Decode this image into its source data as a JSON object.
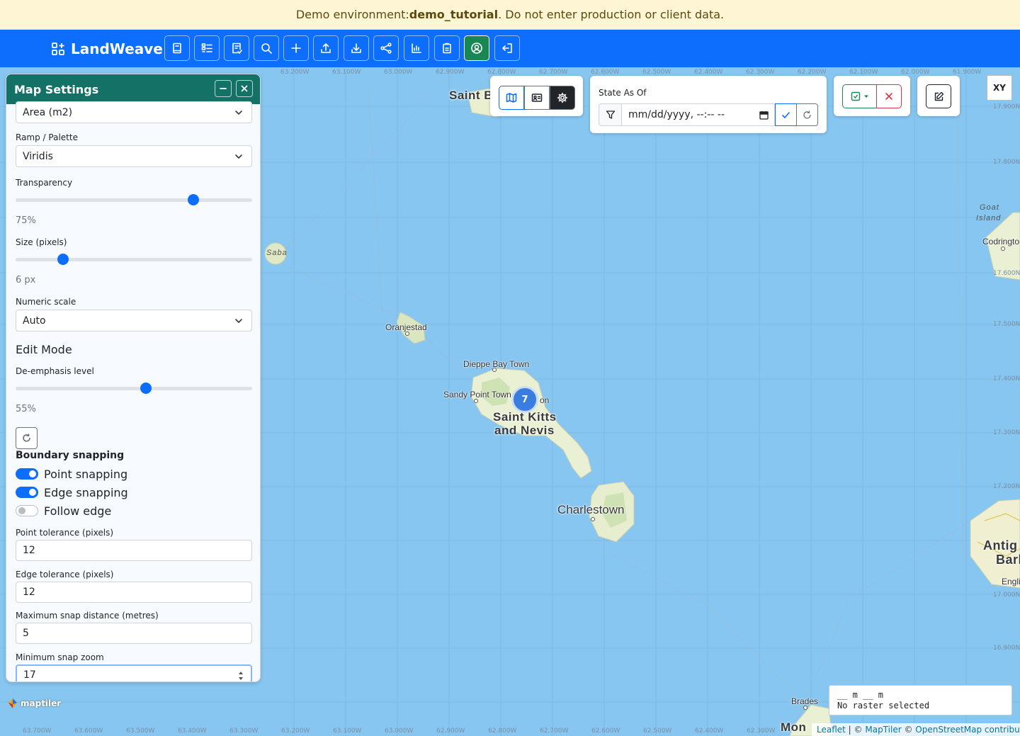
{
  "banner": {
    "prefix": "Demo environment: ",
    "env": "demo_tutorial",
    "suffix": ". Do not enter production or client data."
  },
  "navbar": {
    "brand": "LandWeave",
    "buttons": [
      "book-icon",
      "list-icon",
      "review-icon",
      "search-icon",
      "plus-icon",
      "upload-icon",
      "download-icon",
      "network-icon",
      "chart-icon",
      "clipboard-icon",
      "user-circle-icon",
      "logout-icon"
    ]
  },
  "map_settings": {
    "title": "Map Settings",
    "attribute_value": "Area (m2)",
    "ramp_label": "Ramp / Palette",
    "ramp_value": "Viridis",
    "transparency_label": "Transparency",
    "transparency_pct": 75,
    "transparency_text": "75%",
    "size_label": "Size (pixels)",
    "size_value": 6,
    "size_max": 30,
    "size_text": "6 px",
    "numeric_scale_label": "Numeric scale",
    "numeric_scale_value": "Auto",
    "edit_mode_heading": "Edit Mode",
    "deemphasis_label": "De-emphasis level",
    "deemphasis_pct": 55,
    "deemphasis_text": "55%",
    "boundary_snapping_heading": "Boundary snapping",
    "point_snapping": {
      "label": "Point snapping",
      "on": true
    },
    "edge_snapping": {
      "label": "Edge snapping",
      "on": true
    },
    "follow_edge": {
      "label": "Follow edge",
      "on": false
    },
    "point_tolerance_label": "Point tolerance (pixels)",
    "point_tolerance_value": "12",
    "edge_tolerance_label": "Edge tolerance (pixels)",
    "edge_tolerance_value": "12",
    "max_snap_label": "Maximum snap distance (metres)",
    "max_snap_value": "5",
    "min_snap_zoom_label": "Minimum snap zoom",
    "min_snap_zoom_value": "17"
  },
  "toolbar": {
    "views": [
      "map-icon",
      "id-card-icon",
      "gear-icon"
    ],
    "state_as_of_label": "State As Of",
    "datetime_placeholder": "mm/dd/yyyy, --:-- --"
  },
  "map": {
    "top_coords": [
      "63.200W",
      "63.100W",
      "63.000W",
      "62.900W",
      "62.800W",
      "62.700W",
      "62.600W",
      "62.500W",
      "62.400W",
      "62.300W",
      "62.200W",
      "62.100W",
      "62.000W",
      "61.900W"
    ],
    "bottom_coords": [
      "63.700W",
      "63.600W",
      "63.500W",
      "63.400W",
      "63.300W",
      "63.200W",
      "63.100W",
      "63.000W",
      "62.900W",
      "62.800W",
      "62.700W",
      "62.600W",
      "62.500W",
      "62.400W",
      "62.300W"
    ],
    "right_coords": [
      "17.900N",
      "17.800N",
      "17.600N",
      "17.500N",
      "17.400N",
      "17.300N",
      "17.200N",
      "17.000N",
      "16.900N"
    ],
    "places": {
      "saint_barth": "Saint Barthélemy",
      "saba": "Saba",
      "oranjestad": "Oranjestad",
      "dieppe": "Dieppe Bay Town",
      "sandy_point": "Sandy Point Town",
      "basseterre_frag": "on",
      "skn_line1": "Saint Kitts",
      "skn_line2": "and Nevis",
      "charlestown": "Charlestown",
      "goat_island_1": "Goat",
      "goat_island_2": "Island",
      "codrington": "Codrington",
      "antigua_1": "Antig",
      "antigua_2": "Barb",
      "engl": "Engli",
      "brades": "Brades",
      "mont": "Mon"
    },
    "cluster_count": "7",
    "xy_button": "XY",
    "scale_line": "__ m __ m",
    "raster_status": "No raster selected",
    "maptiler_logo": "maptiler",
    "attribution": {
      "leaflet": "Leaflet",
      "sep1": " | © ",
      "maptiler": "MapTiler",
      "sep2": " © ",
      "osm": "OpenStreetMap contributors"
    }
  },
  "colors": {
    "navbar": "#0d6efd",
    "panel_header": "#137166",
    "banner_bg": "#fdf5d3",
    "sea": "#86c6f0",
    "accent": "#0d6efd"
  }
}
